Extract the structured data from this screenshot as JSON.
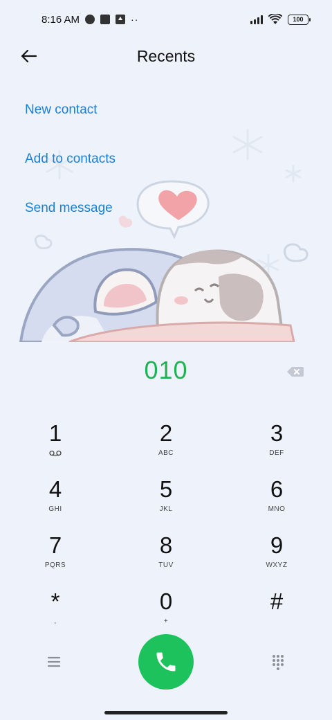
{
  "status_bar": {
    "time": "8:16 AM",
    "dots": "··",
    "battery": "100"
  },
  "header": {
    "title": "Recents",
    "back_icon": "arrow-left-icon"
  },
  "actions": {
    "new_contact": "New contact",
    "add_to_contacts": "Add to contacts",
    "send_message": "Send message"
  },
  "dialer": {
    "number": "010"
  },
  "keypad": {
    "keys": [
      {
        "digit": "1",
        "letters": ""
      },
      {
        "digit": "2",
        "letters": "ABC"
      },
      {
        "digit": "3",
        "letters": "DEF"
      },
      {
        "digit": "4",
        "letters": "GHI"
      },
      {
        "digit": "5",
        "letters": "JKL"
      },
      {
        "digit": "6",
        "letters": "MNO"
      },
      {
        "digit": "7",
        "letters": "PQRS"
      },
      {
        "digit": "8",
        "letters": "TUV"
      },
      {
        "digit": "9",
        "letters": "WXYZ"
      },
      {
        "digit": "*",
        "letters": ","
      },
      {
        "digit": "0",
        "letters": "+"
      },
      {
        "digit": "#",
        "letters": ""
      }
    ]
  },
  "colors": {
    "background": "#eef3fb",
    "accent_blue": "#1a7fd6",
    "number_green": "#1fb254",
    "call_green": "#1ec25c"
  }
}
